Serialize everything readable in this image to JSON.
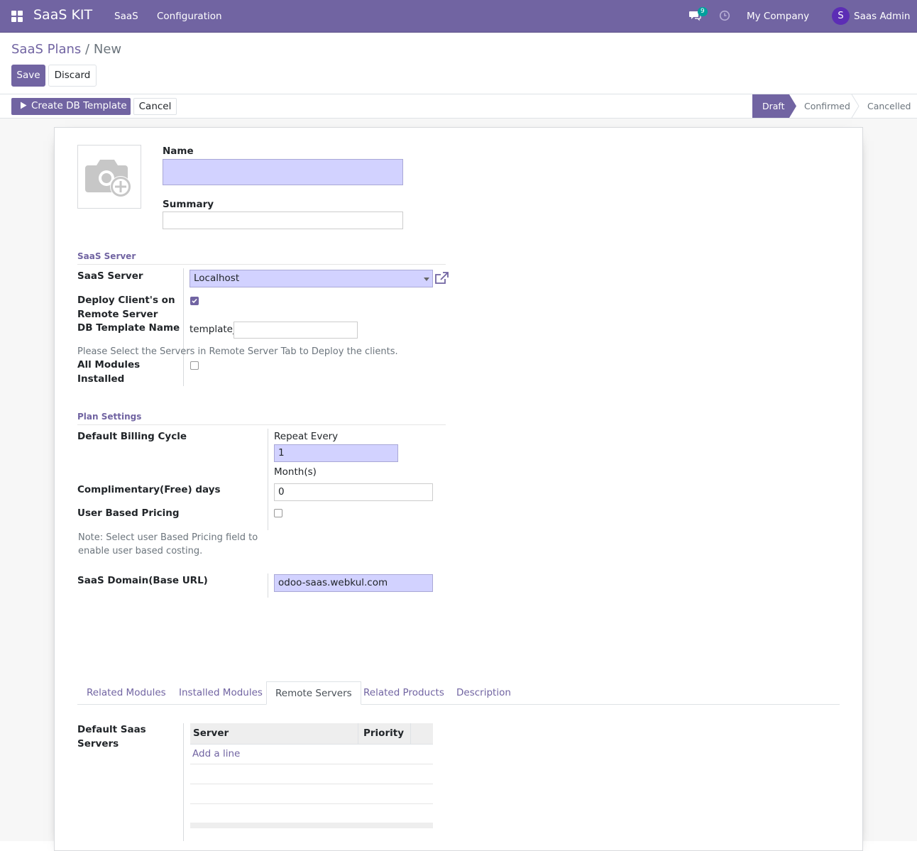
{
  "navbar": {
    "brand": "SaaS KIT",
    "menu": [
      "SaaS",
      "Configuration"
    ],
    "message_count": "9",
    "company": "My Company",
    "avatar_letter": "S",
    "user": "Saas Admin"
  },
  "breadcrumb": {
    "parent": "SaaS Plans",
    "separator": "/",
    "current": "New"
  },
  "actions": {
    "save": "Save",
    "discard": "Discard"
  },
  "header": {
    "create_db_template": "Create DB Template",
    "cancel": "Cancel",
    "stages": [
      "Draft",
      "Confirmed",
      "Cancelled"
    ],
    "active_stage": "Draft"
  },
  "form": {
    "name_label": "Name",
    "name_value": "",
    "summary_label": "Summary",
    "summary_value": "",
    "saas_server_section": "SaaS Server",
    "saas_server_label": "SaaS Server",
    "saas_server_value": "Localhost",
    "deploy_label": "Deploy Client's on Remote Server",
    "deploy_checked": true,
    "db_template_label": "DB Template Name",
    "db_template_prefix": "template_",
    "db_template_value": "",
    "remote_note": "Please Select the Servers in Remote Server Tab to Deploy the clients.",
    "all_modules_label": "All Modules Installed",
    "all_modules_checked": false,
    "plan_settings_section": "Plan Settings",
    "billing_cycle_label": "Default Billing Cycle",
    "repeat_every_label": "Repeat Every",
    "repeat_every_value": "1",
    "months_label": "Month(s)",
    "free_days_label": "Complimentary(Free) days",
    "free_days_value": "0",
    "user_pricing_label": "User Based Pricing",
    "user_pricing_checked": false,
    "user_pricing_note": "Note: Select user Based Pricing field to enable user based costing.",
    "domain_label": "SaaS Domain(Base URL)",
    "domain_value": "odoo-saas.webkul.com"
  },
  "tabs": [
    "Related Modules",
    "Installed Modules",
    "Remote Servers",
    "Related Products",
    "Description"
  ],
  "active_tab": "Remote Servers",
  "remote_servers": {
    "label": "Default Saas Servers",
    "columns": [
      "Server",
      "Priority"
    ],
    "add_line": "Add a line"
  },
  "colors": {
    "primary": "#7164a2",
    "required_bg": "#d2d2ff",
    "badge": "#00a09d"
  },
  "icons": [
    "apps-icon",
    "chat-icon",
    "clock-icon",
    "camera-plus-icon",
    "external-link-icon",
    "play-icon",
    "caret-down-icon",
    "check-icon"
  ]
}
